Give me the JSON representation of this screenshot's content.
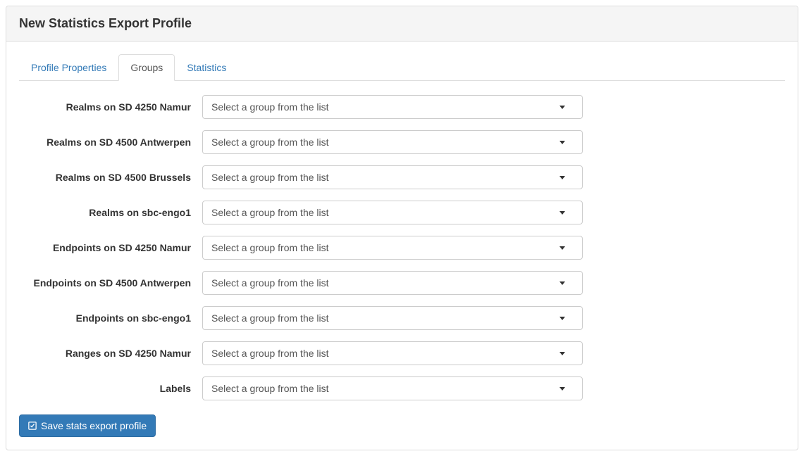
{
  "page_title": "New Statistics Export Profile",
  "tabs": [
    {
      "label": "Profile Properties",
      "active": false
    },
    {
      "label": "Groups",
      "active": true
    },
    {
      "label": "Statistics",
      "active": false
    }
  ],
  "placeholder": "Select a group from the list",
  "fields": [
    {
      "label": "Realms on SD 4250 Namur"
    },
    {
      "label": "Realms on SD 4500 Antwerpen"
    },
    {
      "label": "Realms on SD 4500 Brussels"
    },
    {
      "label": "Realms on sbc-engo1"
    },
    {
      "label": "Endpoints on SD 4250 Namur"
    },
    {
      "label": "Endpoints on SD 4500 Antwerpen"
    },
    {
      "label": "Endpoints on sbc-engo1"
    },
    {
      "label": "Ranges on SD 4250 Namur"
    },
    {
      "label": "Labels"
    }
  ],
  "save_button": "Save stats export profile"
}
